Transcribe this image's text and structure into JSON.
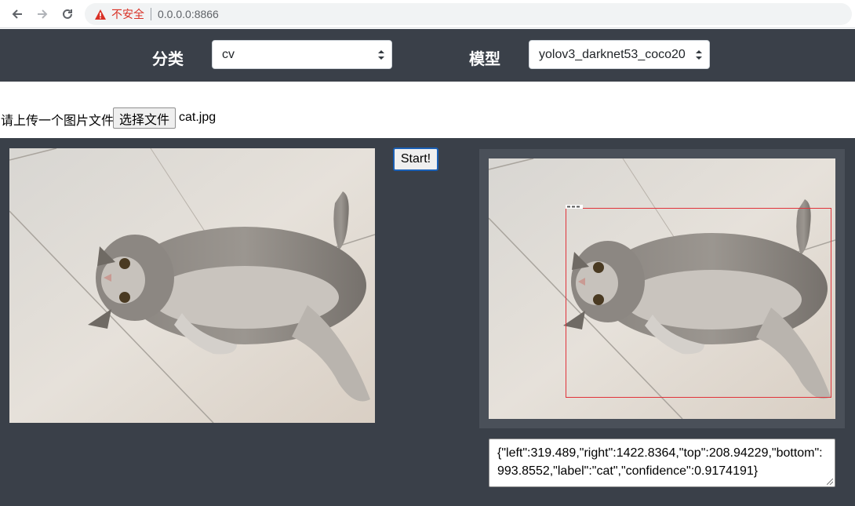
{
  "browser": {
    "security_label": "不安全",
    "url": "0.0.0.0:8866"
  },
  "header": {
    "category_label": "分类",
    "category_value": "cv",
    "model_label": "模型",
    "model_value": "yolov3_darknet53_coco20"
  },
  "upload": {
    "label": "请上传一个图片文件",
    "button_label": "选择文件",
    "file_name": "cat.jpg"
  },
  "actions": {
    "start_label": "Start!"
  },
  "result": {
    "json_text": "{\"left\":319.489,\"right\":1422.8364,\"top\":208.94229,\"bottom\":993.8552,\"label\":\"cat\",\"confidence\":0.9174191}",
    "detection_label": "cat"
  },
  "colors": {
    "panel_bg": "#3a4049",
    "bbox": "#e0333a",
    "warning": "#d93025"
  }
}
